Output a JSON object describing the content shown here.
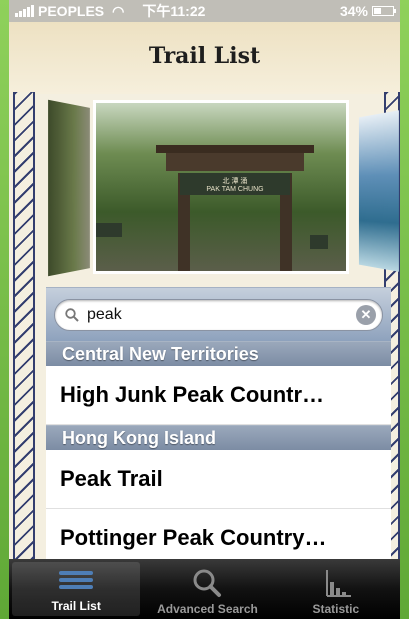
{
  "status_bar": {
    "carrier": "PEOPLES",
    "time": "下午11:22",
    "battery_percent": "34%"
  },
  "header": {
    "title": "Trail List"
  },
  "carousel": {
    "main_photo_sign_text": "北 潭 涌",
    "main_photo_sign_subtext": "PAK TAM CHUNG"
  },
  "search": {
    "value": "peak",
    "placeholder": ""
  },
  "list": {
    "sections": [
      {
        "title": "Central New Territories",
        "rows": [
          "High Junk Peak Countr…"
        ]
      },
      {
        "title": "Hong Kong Island",
        "rows": [
          "Peak Trail",
          "Pottinger Peak Country…"
        ]
      }
    ]
  },
  "tabbar": {
    "tabs": [
      {
        "label": "Trail List",
        "icon": "list-icon",
        "active": true
      },
      {
        "label": "Advanced Search",
        "icon": "magnifier-icon",
        "active": false
      },
      {
        "label": "Statistic",
        "icon": "bar-chart-icon",
        "active": false
      }
    ]
  },
  "colors": {
    "accent": "#4e7eb6",
    "section_header": "#8a98ae",
    "background_green": "#7dc24a"
  }
}
